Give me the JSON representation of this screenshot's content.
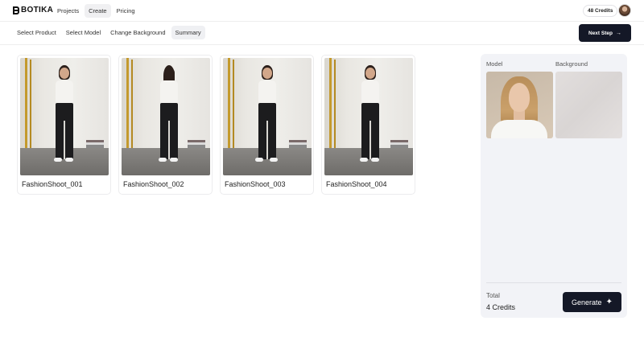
{
  "app": {
    "logo": "BOTIKA"
  },
  "nav": {
    "items": [
      "Projects",
      "Create",
      "Pricing"
    ],
    "active": "Create"
  },
  "account": {
    "credits": "48 Credits"
  },
  "steps": {
    "items": [
      "Select Product",
      "Select Model",
      "Change Background",
      "Summary"
    ],
    "active": "Summary"
  },
  "actions": {
    "next_label": "Next Step"
  },
  "shoots": [
    {
      "title": "FashionShoot_001"
    },
    {
      "title": "FashionShoot_002"
    },
    {
      "title": "FashionShoot_003"
    },
    {
      "title": "FashionShoot_004"
    }
  ],
  "summary": {
    "model_label": "Model",
    "background_label": "Background",
    "total_label": "Total",
    "total_value": "4 Credits",
    "generate_label": "Generate"
  },
  "colors": {
    "primary_button": "#141827",
    "panel_bg": "#f2f3f7"
  },
  "icons": {
    "next": "arrow-right-icon",
    "generate": "sparkle-icon"
  }
}
